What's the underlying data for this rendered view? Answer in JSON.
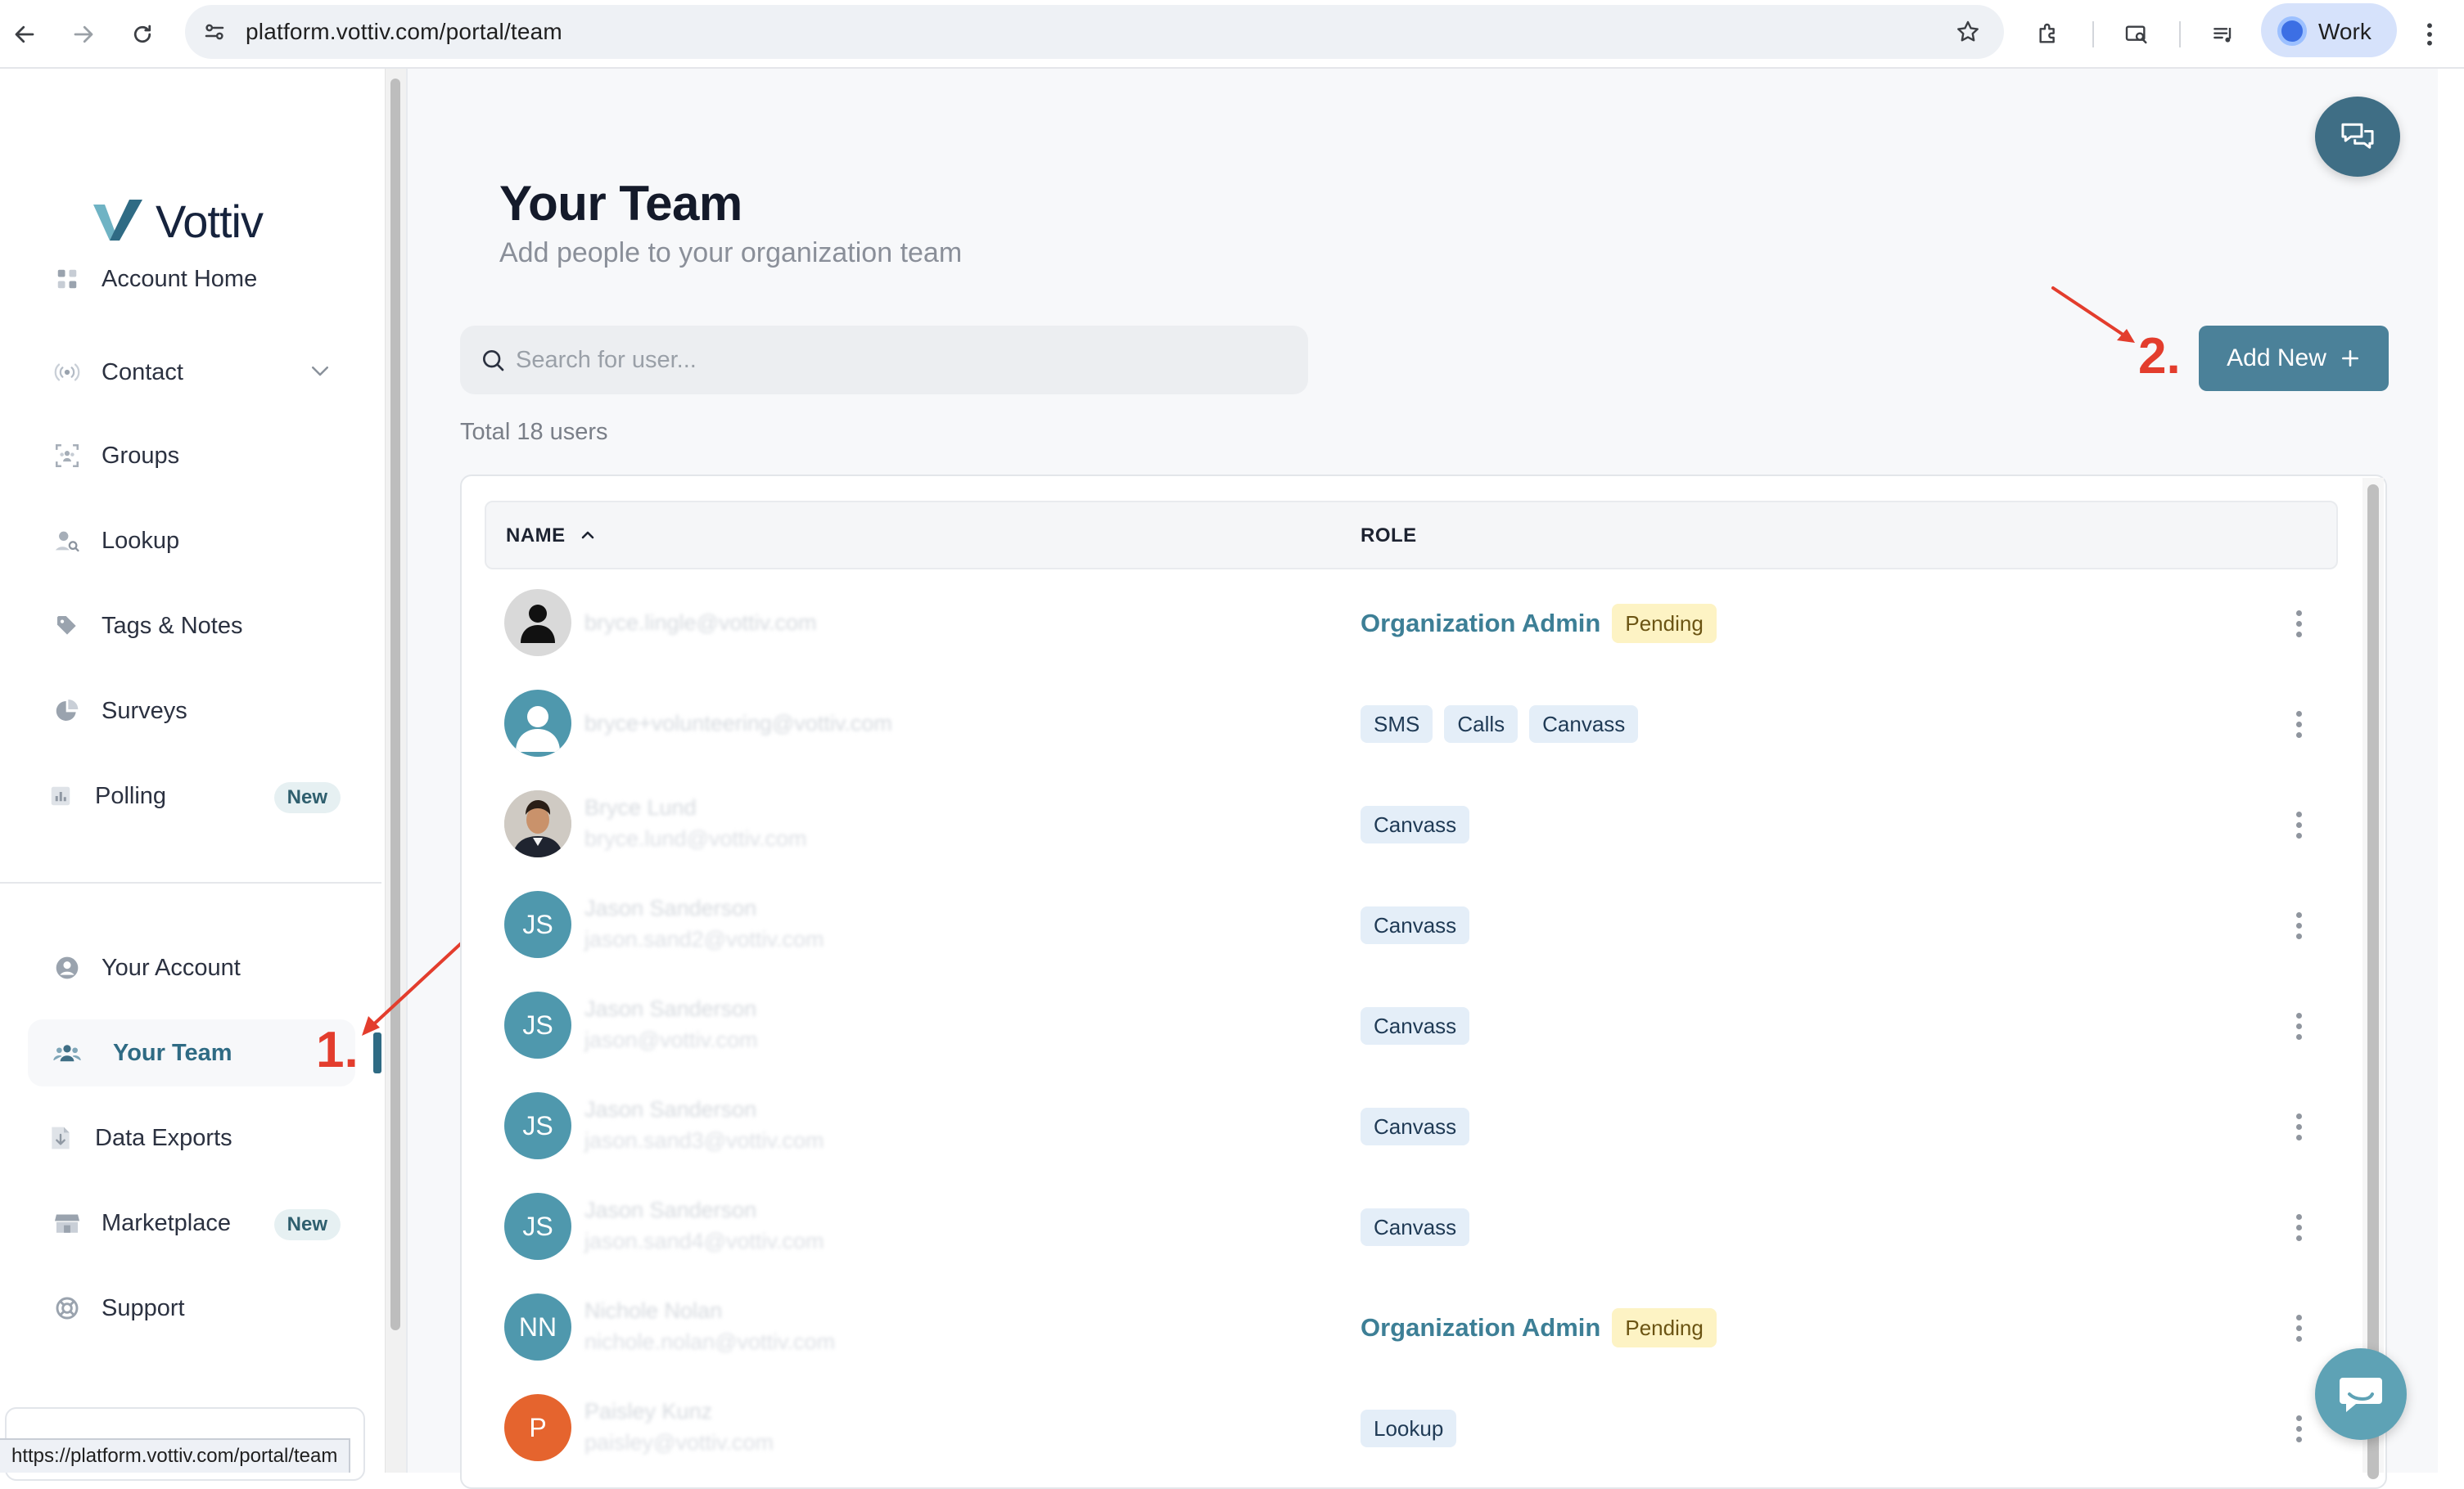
{
  "browser": {
    "url": "platform.vottiv.com/portal/team",
    "profile_label": "Work",
    "status_url": "https://platform.vottiv.com/portal/team"
  },
  "sidebar": {
    "logo_text": "Vottiv",
    "items": [
      {
        "label": "Account Home",
        "icon": "dashboard-icon"
      },
      {
        "label": "Contact",
        "icon": "broadcast-icon"
      },
      {
        "label": "Groups",
        "icon": "group-scan-icon"
      },
      {
        "label": "Lookup",
        "icon": "user-search-icon"
      },
      {
        "label": "Tags & Notes",
        "icon": "tag-icon"
      },
      {
        "label": "Surveys",
        "icon": "pie-chart-icon"
      },
      {
        "label": "Polling",
        "icon": "bar-chart-icon",
        "badge": "New"
      },
      {
        "label": "Your Account",
        "icon": "user-circle-icon"
      },
      {
        "label": "Your Team",
        "icon": "team-icon"
      },
      {
        "label": "Data Exports",
        "icon": "file-download-icon"
      },
      {
        "label": "Marketplace",
        "icon": "store-icon",
        "badge": "New"
      },
      {
        "label": "Support",
        "icon": "lifebuoy-icon"
      }
    ]
  },
  "main": {
    "title": "Your Team",
    "subtitle": "Add people to your organization team",
    "search_placeholder": "Search for user...",
    "total": "Total 18 users",
    "add_button": "Add New",
    "annotation_1": "1.",
    "annotation_2": "2.",
    "table": {
      "col_name": "NAME",
      "col_role": "ROLE",
      "rows": [
        {
          "avatar": "",
          "avatar_type": "silhouette-dark",
          "name": "",
          "email": "bryce.lingle@vottiv.com",
          "role": "Organization Admin",
          "status": "Pending"
        },
        {
          "avatar": "",
          "avatar_type": "silhouette-teal",
          "name": "",
          "email": "bryce+volunteering@vottiv.com",
          "chips": [
            "SMS",
            "Calls",
            "Canvass"
          ]
        },
        {
          "avatar": "",
          "avatar_type": "photo",
          "name": "Bryce Lund",
          "email": "bryce.lund@vottiv.com",
          "chips": [
            "Canvass"
          ]
        },
        {
          "avatar": "JS",
          "avatar_type": "initials",
          "name": "Jason Sanderson",
          "email": "jason.sand2@vottiv.com",
          "chips": [
            "Canvass"
          ]
        },
        {
          "avatar": "JS",
          "avatar_type": "initials",
          "name": "Jason Sanderson",
          "email": "jason@vottiv.com",
          "chips": [
            "Canvass"
          ]
        },
        {
          "avatar": "JS",
          "avatar_type": "initials",
          "name": "Jason Sanderson",
          "email": "jason.sand3@vottiv.com",
          "chips": [
            "Canvass"
          ]
        },
        {
          "avatar": "JS",
          "avatar_type": "initials",
          "name": "Jason Sanderson",
          "email": "jason.sand4@vottiv.com",
          "chips": [
            "Canvass"
          ]
        },
        {
          "avatar": "NN",
          "avatar_type": "initials",
          "name": "Nichole Nolan",
          "email": "nichole.nolan@vottiv.com",
          "role": "Organization Admin",
          "status": "Pending"
        },
        {
          "avatar": "P",
          "avatar_type": "initials-orange",
          "name": "Paisley Kunz",
          "email": "paisley@vottiv.com",
          "chips": [
            "Lookup"
          ]
        }
      ]
    }
  },
  "colors": {
    "brand": "#4b8199",
    "brand_dark": "#3f6e85",
    "accent_text": "#3d7f96",
    "annotation": "#e33d2d",
    "pending_bg": "#fdf3c4",
    "chip_bg": "#e4eef8"
  }
}
